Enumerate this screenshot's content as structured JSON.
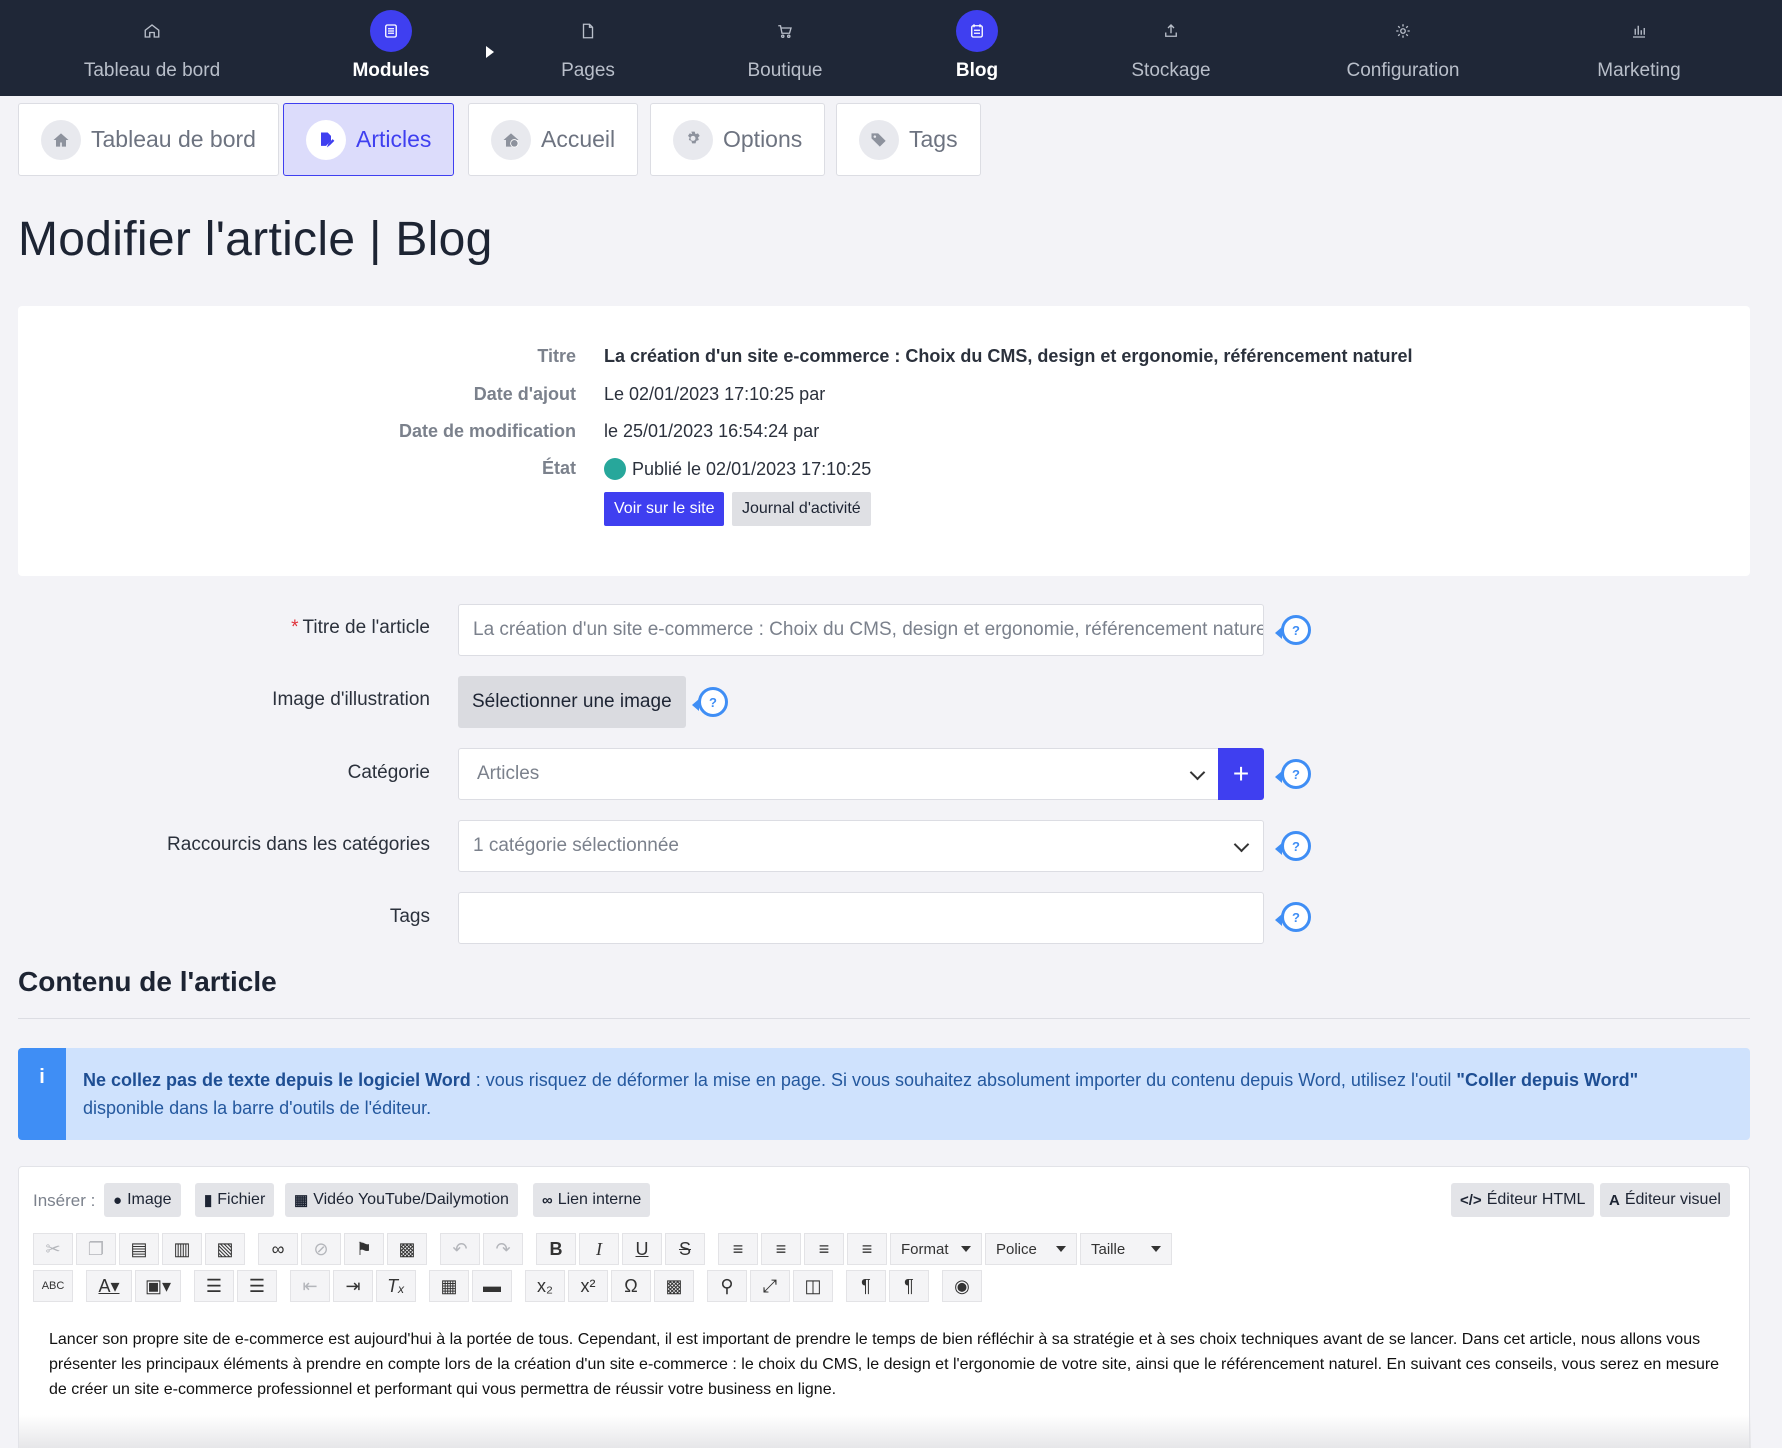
{
  "topnav": {
    "items": [
      {
        "label": "Tableau de bord",
        "icon": "home-icon",
        "active": false
      },
      {
        "label": "Modules",
        "icon": "list-icon",
        "active": true
      },
      {
        "label": "Pages",
        "icon": "page-icon",
        "active": false
      },
      {
        "label": "Boutique",
        "icon": "cart-icon",
        "active": false
      },
      {
        "label": "Blog",
        "icon": "calendar-icon",
        "active": true
      },
      {
        "label": "Stockage",
        "icon": "upload-icon",
        "active": false
      },
      {
        "label": "Configuration",
        "icon": "gear-icon",
        "active": false
      },
      {
        "label": "Marketing",
        "icon": "chart-icon",
        "active": false
      }
    ]
  },
  "subtabs": [
    {
      "label": "Tableau de bord",
      "icon": "home-icon"
    },
    {
      "label": "Articles",
      "icon": "edit-doc-icon",
      "active": true
    },
    {
      "label": "Accueil",
      "icon": "home-check-icon"
    },
    {
      "label": "Options",
      "icon": "gear-icon"
    },
    {
      "label": "Tags",
      "icon": "tags-icon"
    }
  ],
  "page_title": "Modifier l'article | Blog",
  "info": {
    "title_label": "Titre",
    "title_value": "La création d'un site e-commerce : Choix du CMS, design et ergonomie, référencement naturel",
    "added_label": "Date d'ajout",
    "added_value": "Le 02/01/2023 17:10:25 par",
    "modified_label": "Date de modification",
    "modified_value": "le 25/01/2023 16:54:24 par",
    "state_label": "État",
    "state_value": "Publié le 02/01/2023 17:10:25",
    "state_color": "#27a79b",
    "view_site_label": "Voir sur le site",
    "journal_label": "Journal d'activité"
  },
  "form": {
    "title_label": "Titre de l'article",
    "title_value": "La création d'un site e-commerce : Choix du CMS, design et ergonomie, référencement naturel",
    "image_label": "Image d'illustration",
    "image_button": "Sélectionner une image",
    "category_label": "Catégorie",
    "category_value": "Articles",
    "shortcuts_label": "Raccourcis dans les catégories",
    "shortcuts_value": "1 catégorie sélectionnée",
    "tags_label": "Tags",
    "tags_value": "",
    "help_glyph": "?",
    "plus_glyph": "+"
  },
  "content": {
    "section_title": "Contenu de l'article",
    "alert_icon": "i",
    "alert_bold1": "Ne collez pas de texte depuis le logiciel Word",
    "alert_text1": " : vous risquez de déformer la mise en page. Si vous souhaitez absolument importer du contenu depuis Word, utilisez l'outil ",
    "alert_bold2": "\"Coller depuis Word\"",
    "alert_text2": " disponible dans la barre d'outils de l'éditeur."
  },
  "editor": {
    "insert_label": "Insérer :",
    "insert_image": "Image",
    "insert_file": "Fichier",
    "insert_video": "Vidéo YouTube/Dailymotion",
    "insert_link": "Lien interne",
    "html_editor": "Éditeur HTML",
    "visual_editor": "Éditeur visuel",
    "format_label": "Format",
    "font_label": "Police",
    "size_label": "Taille",
    "body": "Lancer son propre site de e-commerce est aujourd'hui à la portée de tous. Cependant, il est important de prendre le temps de bien réfléchir à sa stratégie et à ses choix techniques avant de se lancer. Dans cet article, nous allons vous présenter les principaux éléments à prendre en compte lors de la création d'un site e-commerce : le choix du CMS, le design et l'ergonomie de votre site, ainsi que le référencement naturel. En suivant ces conseils, vous serez en mesure de créer un site e-commerce professionnel et performant qui vous permettra de réussir votre business en ligne."
  },
  "colors": {
    "accent": "#3f3ff0",
    "nav_bg": "#1f2737",
    "help": "#3f8ef5",
    "alert_bg": "#cfe2fd"
  }
}
